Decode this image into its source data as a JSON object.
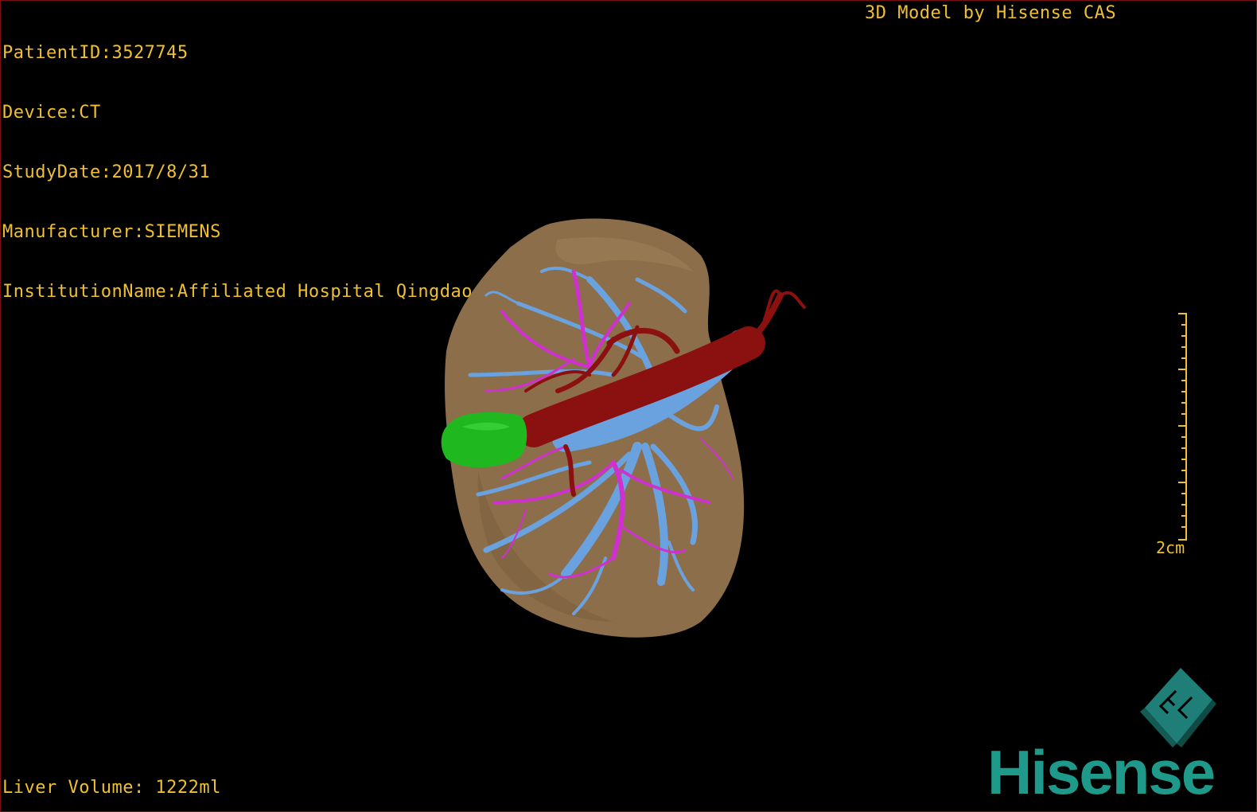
{
  "info": {
    "patient_id": "PatientID:3527745",
    "device": "Device:CT",
    "study_date": "StudyDate:2017/8/31",
    "manufacturer": "Manufacturer:SIEMENS",
    "institution": "InstitutionName:Affiliated Hospital Qingdao University-C"
  },
  "tag": "3D Model by Hisense CAS",
  "liver_volume": "Liver Volume: 1222ml",
  "scale": {
    "label": "2cm",
    "length_cm": 2
  },
  "orientation_cube": {
    "face_label": "FL"
  },
  "brand": "Hisense",
  "colors": {
    "overlay_text": "#f0c030",
    "liver": "#8c6f4a",
    "portal_vein": "#6aa2e0",
    "hepatic_artery": "#8b1010",
    "hepatic_vein": "#d030d0",
    "gallbladder": "#1fb81f",
    "brand": "#1f9a8a"
  }
}
